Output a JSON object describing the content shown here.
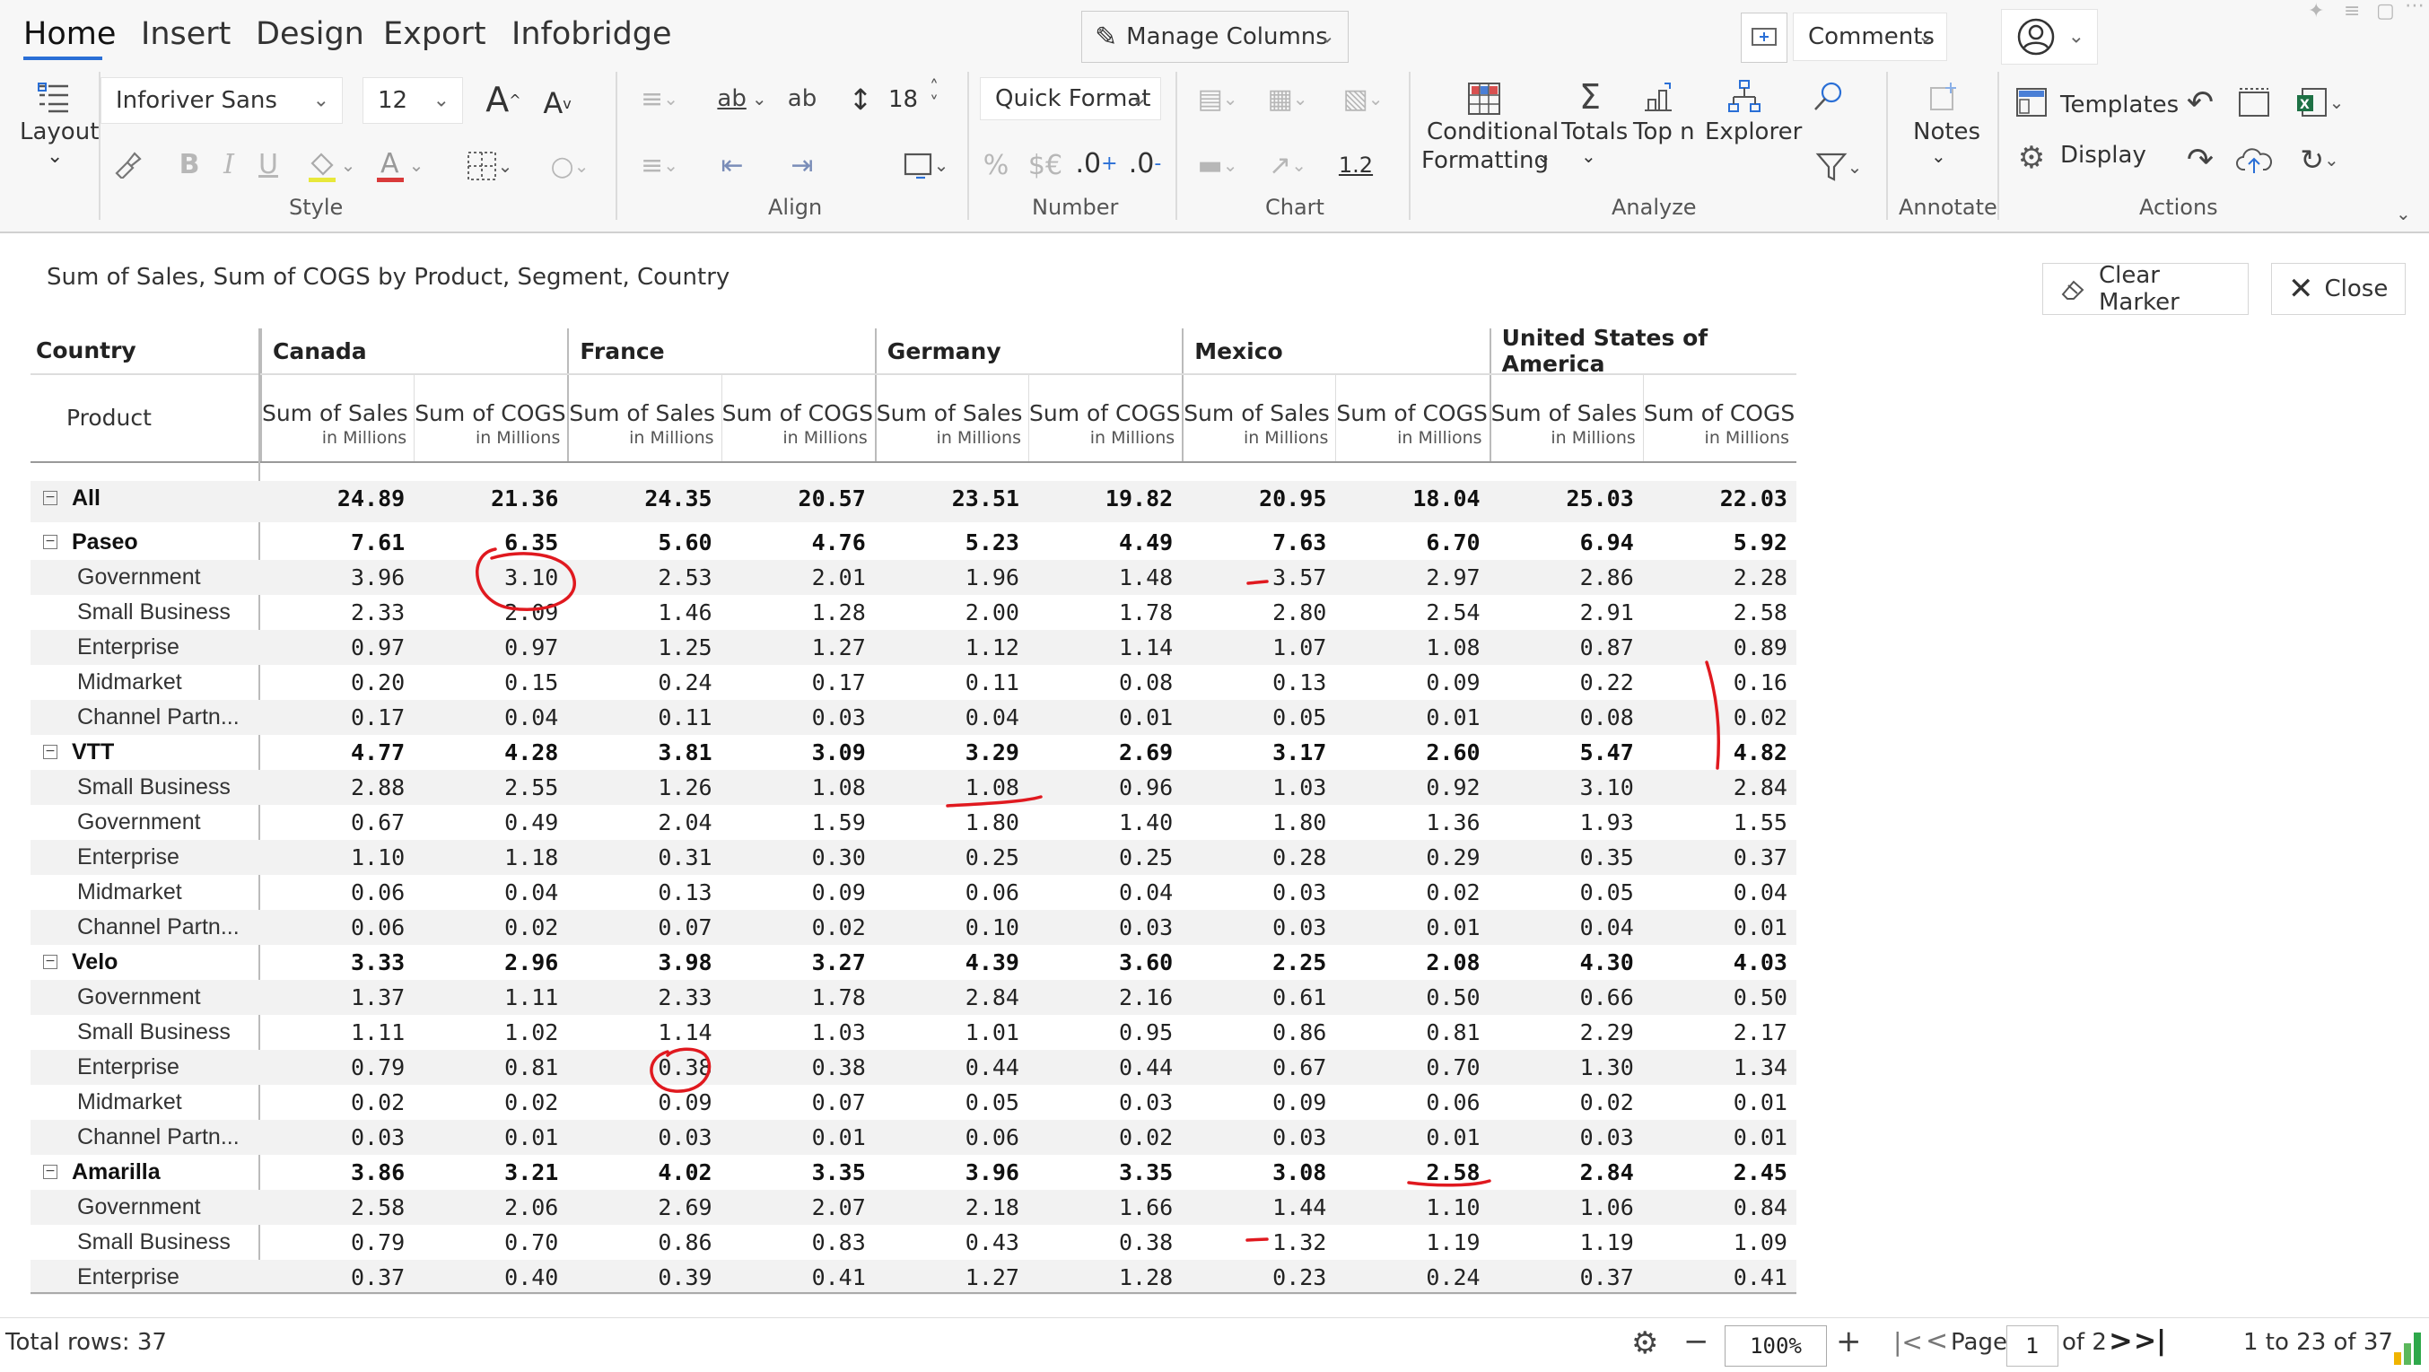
{
  "ribbon": {
    "tabs": [
      "Home",
      "Insert",
      "Design",
      "Export",
      "Infobridge"
    ],
    "manage_columns": "Manage Columns",
    "comments": "Comments",
    "layout": "Layout",
    "font_family": "Inforiver Sans",
    "font_size": "12",
    "line_height": "18",
    "number_format": "Quick Format",
    "decimal_value": "1.2",
    "conditional_formatting_1": "Conditional",
    "conditional_formatting_2": "Formatting",
    "totals": "Totals",
    "top_n": "Top n",
    "explorer": "Explorer",
    "notes": "Notes",
    "templates": "Templates",
    "display": "Display",
    "groups": {
      "style": "Style",
      "align": "Align",
      "number": "Number",
      "chart": "Chart",
      "analyze": "Analyze",
      "annotate": "Annotate",
      "actions": "Actions"
    },
    "number_symbols": {
      "percent": "%",
      "currency": "$€",
      "inc_decimal": ".0",
      "dec_decimal": ".0"
    }
  },
  "toolbar": {
    "subtitle": "Sum of Sales, Sum of COGS by Product, Segment, Country",
    "clear_marker": "Clear Marker",
    "close": "Close"
  },
  "table": {
    "country_header": "Country",
    "product_header": "Product",
    "countries": [
      "Canada",
      "France",
      "Germany",
      "Mexico",
      "United States of America"
    ],
    "measures": [
      "Sum of Sales",
      "Sum of COGS"
    ],
    "measure_unit": "in Millions",
    "rows": [
      {
        "label": "All",
        "level": 0,
        "total": true,
        "expander": true,
        "values": [
          "24.89",
          "21.36",
          "24.35",
          "20.57",
          "23.51",
          "19.82",
          "20.95",
          "18.04",
          "25.03",
          "22.03"
        ]
      },
      {
        "label": "Paseo",
        "level": 0,
        "total": true,
        "expander": true,
        "values": [
          "7.61",
          "6.35",
          "5.60",
          "4.76",
          "5.23",
          "4.49",
          "7.63",
          "6.70",
          "6.94",
          "5.92"
        ]
      },
      {
        "label": "Government",
        "level": 1,
        "values": [
          "3.96",
          "3.10",
          "2.53",
          "2.01",
          "1.96",
          "1.48",
          "3.57",
          "2.97",
          "2.86",
          "2.28"
        ]
      },
      {
        "label": "Small Business",
        "level": 1,
        "values": [
          "2.33",
          "2.09",
          "1.46",
          "1.28",
          "2.00",
          "1.78",
          "2.80",
          "2.54",
          "2.91",
          "2.58"
        ]
      },
      {
        "label": "Enterprise",
        "level": 1,
        "values": [
          "0.97",
          "0.97",
          "1.25",
          "1.27",
          "1.12",
          "1.14",
          "1.07",
          "1.08",
          "0.87",
          "0.89"
        ]
      },
      {
        "label": "Midmarket",
        "level": 1,
        "values": [
          "0.20",
          "0.15",
          "0.24",
          "0.17",
          "0.11",
          "0.08",
          "0.13",
          "0.09",
          "0.22",
          "0.16"
        ]
      },
      {
        "label": "Channel Partn...",
        "level": 1,
        "values": [
          "0.17",
          "0.04",
          "0.11",
          "0.03",
          "0.04",
          "0.01",
          "0.05",
          "0.01",
          "0.08",
          "0.02"
        ]
      },
      {
        "label": "VTT",
        "level": 0,
        "total": true,
        "expander": true,
        "values": [
          "4.77",
          "4.28",
          "3.81",
          "3.09",
          "3.29",
          "2.69",
          "3.17",
          "2.60",
          "5.47",
          "4.82"
        ]
      },
      {
        "label": "Small Business",
        "level": 1,
        "values": [
          "2.88",
          "2.55",
          "1.26",
          "1.08",
          "1.08",
          "0.96",
          "1.03",
          "0.92",
          "3.10",
          "2.84"
        ]
      },
      {
        "label": "Government",
        "level": 1,
        "values": [
          "0.67",
          "0.49",
          "2.04",
          "1.59",
          "1.80",
          "1.40",
          "1.80",
          "1.36",
          "1.93",
          "1.55"
        ]
      },
      {
        "label": "Enterprise",
        "level": 1,
        "values": [
          "1.10",
          "1.18",
          "0.31",
          "0.30",
          "0.25",
          "0.25",
          "0.28",
          "0.29",
          "0.35",
          "0.37"
        ]
      },
      {
        "label": "Midmarket",
        "level": 1,
        "values": [
          "0.06",
          "0.04",
          "0.13",
          "0.09",
          "0.06",
          "0.04",
          "0.03",
          "0.02",
          "0.05",
          "0.04"
        ]
      },
      {
        "label": "Channel Partn...",
        "level": 1,
        "values": [
          "0.06",
          "0.02",
          "0.07",
          "0.02",
          "0.10",
          "0.03",
          "0.03",
          "0.01",
          "0.04",
          "0.01"
        ]
      },
      {
        "label": "Velo",
        "level": 0,
        "total": true,
        "expander": true,
        "values": [
          "3.33",
          "2.96",
          "3.98",
          "3.27",
          "4.39",
          "3.60",
          "2.25",
          "2.08",
          "4.30",
          "4.03"
        ]
      },
      {
        "label": "Government",
        "level": 1,
        "values": [
          "1.37",
          "1.11",
          "2.33",
          "1.78",
          "2.84",
          "2.16",
          "0.61",
          "0.50",
          "0.66",
          "0.50"
        ]
      },
      {
        "label": "Small Business",
        "level": 1,
        "values": [
          "1.11",
          "1.02",
          "1.14",
          "1.03",
          "1.01",
          "0.95",
          "0.86",
          "0.81",
          "2.29",
          "2.17"
        ]
      },
      {
        "label": "Enterprise",
        "level": 1,
        "values": [
          "0.79",
          "0.81",
          "0.38",
          "0.38",
          "0.44",
          "0.44",
          "0.67",
          "0.70",
          "1.30",
          "1.34"
        ]
      },
      {
        "label": "Midmarket",
        "level": 1,
        "values": [
          "0.02",
          "0.02",
          "0.09",
          "0.07",
          "0.05",
          "0.03",
          "0.09",
          "0.06",
          "0.02",
          "0.01"
        ]
      },
      {
        "label": "Channel Partn...",
        "level": 1,
        "values": [
          "0.03",
          "0.01",
          "0.03",
          "0.01",
          "0.06",
          "0.02",
          "0.03",
          "0.01",
          "0.03",
          "0.01"
        ]
      },
      {
        "label": "Amarilla",
        "level": 0,
        "total": true,
        "expander": true,
        "values": [
          "3.86",
          "3.21",
          "4.02",
          "3.35",
          "3.96",
          "3.35",
          "3.08",
          "2.58",
          "2.84",
          "2.45"
        ]
      },
      {
        "label": "Government",
        "level": 1,
        "values": [
          "2.58",
          "2.06",
          "2.69",
          "2.07",
          "2.18",
          "1.66",
          "1.44",
          "1.10",
          "1.06",
          "0.84"
        ]
      },
      {
        "label": "Small Business",
        "level": 1,
        "values": [
          "0.79",
          "0.70",
          "0.86",
          "0.83",
          "0.43",
          "0.38",
          "1.32",
          "1.19",
          "1.19",
          "1.09"
        ]
      },
      {
        "label": "Enterprise",
        "level": 1,
        "values": [
          "0.37",
          "0.40",
          "0.39",
          "0.41",
          "1.27",
          "1.28",
          "0.23",
          "0.24",
          "0.37",
          "0.41"
        ]
      }
    ]
  },
  "footer": {
    "total_rows": "Total rows: 37",
    "zoom": "100%",
    "page_label": "Page",
    "page_value": "1",
    "page_of": "of 2",
    "range": "1  to  23  of  37"
  },
  "colors": {
    "accent": "#2a6fd6",
    "annotation": "#e0191f",
    "excel": "#1e7145"
  }
}
